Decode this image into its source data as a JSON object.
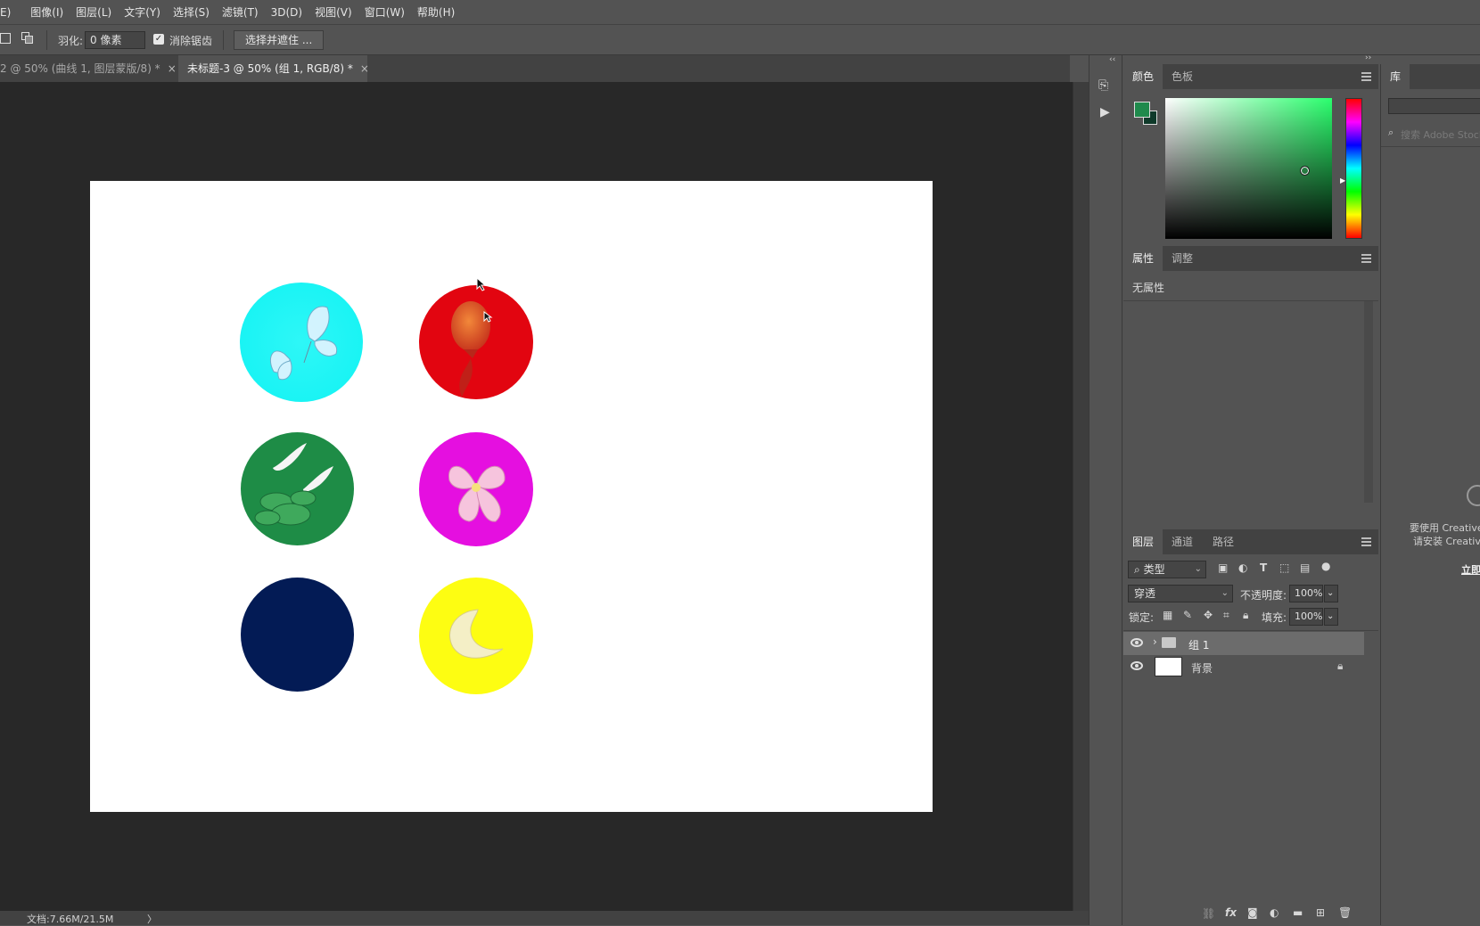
{
  "menu": [
    "E)",
    "图像(I)",
    "图层(L)",
    "文字(Y)",
    "选择(S)",
    "滤镜(T)",
    "3D(D)",
    "视图(V)",
    "窗口(W)",
    "帮助(H)"
  ],
  "options": {
    "feather_label": "羽化:",
    "feather_value": "0 像素",
    "antialias_label": "消除锯齿",
    "antialias_checked": true,
    "select_mask_button": "选择并遮住 ..."
  },
  "tabs": [
    {
      "label": "2 @ 50% (曲线 1, 图层蒙版/8) *",
      "active": false
    },
    {
      "label": "未标题-3 @ 50% (组 1, RGB/8) *",
      "active": true
    }
  ],
  "tab_close": "×",
  "status": {
    "doc_info": "文档:7.66M/21.5M",
    "arrow": "〉"
  },
  "color_panel": {
    "tabs": [
      "颜色",
      "色板"
    ],
    "foreground": "#1f8a4c",
    "background": "#0f3a2a",
    "hue_color": "#2bff6e"
  },
  "properties_panel": {
    "tabs": [
      "属性",
      "调整"
    ],
    "content": "无属性"
  },
  "layers_panel": {
    "tabs": [
      "图层",
      "通道",
      "路径"
    ],
    "filter": "类型",
    "blend_mode": "穿透",
    "opacity_label": "不透明度:",
    "opacity": "100%",
    "lock_label": "锁定:",
    "fill_label": "填充:",
    "fill": "100%",
    "layers": [
      {
        "name": "组 1",
        "type": "group",
        "visible": true,
        "selected": true
      },
      {
        "name": "背景",
        "type": "background",
        "visible": true,
        "locked": true
      }
    ]
  },
  "library_panel": {
    "tab": "库",
    "search_placeholder": "搜索 Adobe Stock",
    "message_line1": "要使用 Creative",
    "message_line2": "请安装 Creativ",
    "link": "立即"
  },
  "canvas_circles": [
    {
      "name": "cyan-butterfly-circle",
      "color": "#17f3f4",
      "icon": "butterfly"
    },
    {
      "name": "red-lantern-circle",
      "color": "#e20510",
      "icon": "lantern"
    },
    {
      "name": "green-crane-circle",
      "color": "#1e8c46",
      "icon": "crane-pine"
    },
    {
      "name": "magenta-flower-circle",
      "color": "#e50fe0",
      "icon": "flower"
    },
    {
      "name": "navy-circle",
      "color": "#031b55",
      "icon": "none"
    },
    {
      "name": "yellow-moon-circle",
      "color": "#fdfd12",
      "icon": "moon"
    }
  ]
}
